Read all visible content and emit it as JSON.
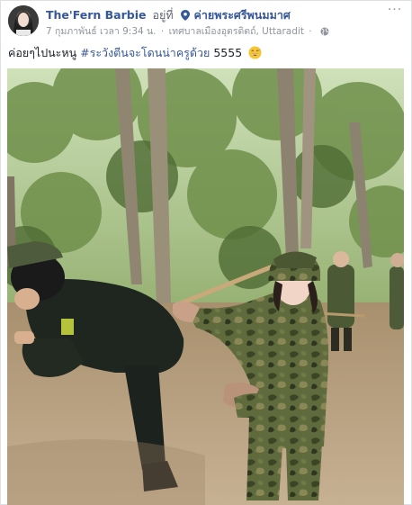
{
  "post": {
    "author": "The'Fern Barbie",
    "verb": "อยู่ที่",
    "place": "ค่ายพระศรีพนมมาศ",
    "timestamp": "7 กุมภาพันธ์ เวลา 9:34 น.",
    "separator": "·",
    "location": "เทศบาลเมืองอุตรดิตถ์, Uttaradit",
    "caption_text": "ค่อยๆไปนะหนู ",
    "caption_hashtag": "#ระวังตีนจะโดนน่าครูด้วย",
    "caption_suffix": " 5555",
    "more_label": "···",
    "emoji": "grinning-sweat-face",
    "privacy_icon": "globe-icon",
    "location_icon": "map-pin-icon"
  },
  "colors": {
    "link": "#365899",
    "meta": "#90949c",
    "text": "#1d2129",
    "border": "#dddfe2"
  }
}
